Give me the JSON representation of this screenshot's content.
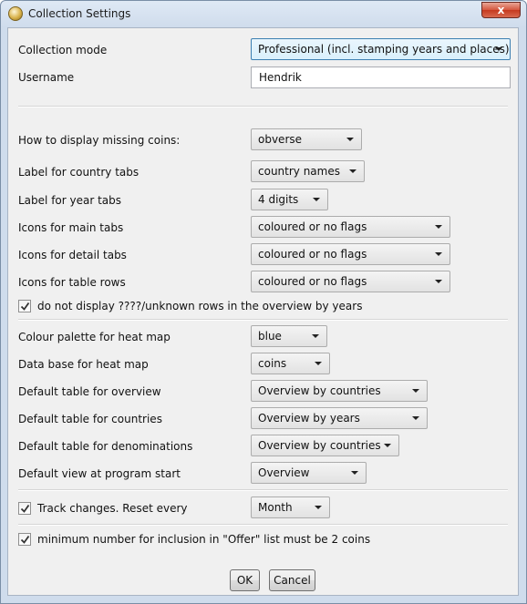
{
  "window": {
    "title": "Collection Settings",
    "close_glyph": "x"
  },
  "collection_mode": {
    "label": "Collection mode",
    "value": "Professional (incl. stamping years and places)"
  },
  "username": {
    "label": "Username",
    "value": "Hendrik"
  },
  "missing_coins": {
    "label": "How to display missing coins:",
    "value": "obverse"
  },
  "country_tabs": {
    "label": "Label for country tabs",
    "value": "country names"
  },
  "year_tabs": {
    "label": "Label for year tabs",
    "value": "4 digits"
  },
  "icons_main": {
    "label": "Icons for main tabs",
    "value": "coloured or no flags"
  },
  "icons_detail": {
    "label": "Icons for detail tabs",
    "value": "coloured or no flags"
  },
  "icons_rows": {
    "label": "Icons for table rows",
    "value": "coloured or no flags"
  },
  "unknown_rows": {
    "label": "do not display ????/unknown rows in the overview by years",
    "checked": true
  },
  "palette": {
    "label": "Colour palette for heat map",
    "value": "blue"
  },
  "database": {
    "label": "Data base for heat map",
    "value": "coins"
  },
  "table_overview": {
    "label": "Default table for overview",
    "value": "Overview by countries"
  },
  "table_countries": {
    "label": "Default table for countries",
    "value": "Overview by years"
  },
  "table_denominations": {
    "label": "Default table for denominations",
    "value": "Overview by countries"
  },
  "default_view": {
    "label": "Default view at program start",
    "value": "Overview"
  },
  "track_changes": {
    "label": "Track changes. Reset every",
    "checked": true,
    "value": "Month"
  },
  "offer": {
    "label": "minimum number for inclusion in \"Offer\" list must be 2 coins",
    "checked": true
  },
  "buttons": {
    "ok": "OK",
    "cancel": "Cancel"
  }
}
